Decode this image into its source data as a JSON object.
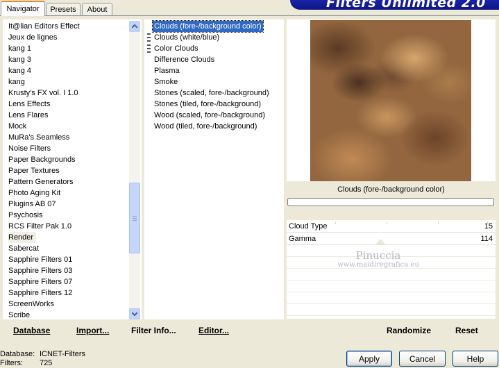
{
  "tabs": [
    {
      "label": "Navigator",
      "active": true
    },
    {
      "label": "Presets",
      "active": false
    },
    {
      "label": "About",
      "active": false
    }
  ],
  "banner": {
    "title": "Filters Unlimited 2.0"
  },
  "categories": {
    "items": [
      "It@lian Editors Effect",
      "Jeux de lignes",
      "kang 1",
      "kang 3",
      "kang 4",
      "kang",
      "Krusty's FX vol. I 1.0",
      "Lens Effects",
      "Lens Flares",
      "Mock",
      "MuRa's Seamless",
      "Noise Filters",
      "Paper Backgrounds",
      "Paper Textures",
      "Pattern Generators",
      "Photo Aging Kit",
      "Plugins AB 07",
      "Psychosis",
      "RCS Filter Pak 1.0",
      "Render",
      "Sabercat",
      "Sapphire Filters 01",
      "Sapphire Filters 03",
      "Sapphire Filters 07",
      "Sapphire Filters 12",
      "ScreenWorks",
      "Scribe"
    ],
    "selected": "Render"
  },
  "filters": {
    "items": [
      {
        "label": "Clouds (fore-/background color)",
        "favorite": false
      },
      {
        "label": "Clouds (white/blue)",
        "favorite": true
      },
      {
        "label": "Color Clouds",
        "favorite": true
      },
      {
        "label": "Difference Clouds",
        "favorite": false
      },
      {
        "label": "Plasma",
        "favorite": false
      },
      {
        "label": "Smoke",
        "favorite": false
      },
      {
        "label": "Stones (scaled, fore-/background)",
        "favorite": false
      },
      {
        "label": "Stones (tiled, fore-/background)",
        "favorite": false
      },
      {
        "label": "Wood (scaled, fore-/background)",
        "favorite": false
      },
      {
        "label": "Wood (tiled, fore-/background)",
        "favorite": false
      }
    ],
    "selected": "Clouds (fore-/background color)"
  },
  "preview": {
    "caption": "Clouds (fore-/background color)"
  },
  "parameters": [
    {
      "label": "Cloud Type",
      "value": "15"
    },
    {
      "label": "Gamma",
      "value": "114"
    }
  ],
  "watermark": {
    "name": "Pinuccia",
    "url": "www.maidiregrafica.eu"
  },
  "toolbar": {
    "database": "Database",
    "import": "Import...",
    "filter_info": "Filter Info...",
    "editor": "Editor...",
    "randomize": "Randomize",
    "reset": "Reset"
  },
  "status": {
    "database_label": "Database:",
    "database_value": "ICNET-Filters",
    "filters_label": "Filters:",
    "filters_value": "725"
  },
  "buttons": {
    "apply": "Apply",
    "cancel": "Cancel",
    "help": "Help"
  },
  "colors": {
    "accent": "#316ac5",
    "banner": "#12198a",
    "background": "#ece9d8"
  }
}
